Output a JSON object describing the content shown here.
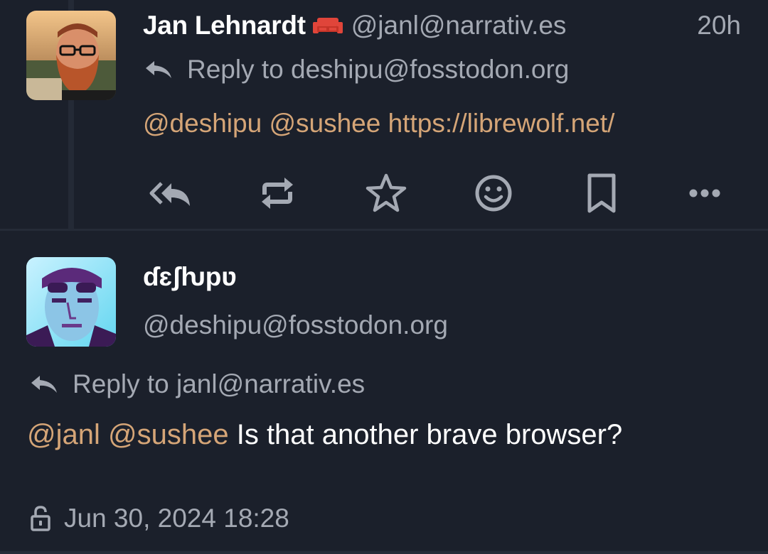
{
  "colors": {
    "background": "#1b202b",
    "accent_mention": "#d5a577",
    "muted_text": "#a4a9b3",
    "primary_text": "#ffffff",
    "bot_badge": "#e0453a"
  },
  "post1": {
    "author_display_name": "Jan Lehnardt",
    "author_badge_icon": "couch-icon",
    "author_handle": "@janl@narrativ.es",
    "relative_time": "20h",
    "reply_to_text": "Reply to deshipu@fosstodon.org",
    "content": {
      "mention1": "@deshipu",
      "mention2": "@sushee",
      "link": "https://librewolf.net/"
    },
    "actions": [
      {
        "name": "reply-all-icon"
      },
      {
        "name": "boost-icon"
      },
      {
        "name": "favourite-icon"
      },
      {
        "name": "emoji-reaction-icon"
      },
      {
        "name": "bookmark-icon"
      },
      {
        "name": "more-options-icon"
      }
    ]
  },
  "post2": {
    "author_display_name": "ɗɛʃƕpʋ",
    "author_handle": "@deshipu@fosstodon.org",
    "reply_to_text": "Reply to janl@narrativ.es",
    "content": {
      "mention1": "@janl",
      "mention2": "@sushee",
      "text": "Is that another brave browser?"
    },
    "visibility_icon": "lock-icon",
    "timestamp": "Jun 30, 2024 18:28"
  }
}
